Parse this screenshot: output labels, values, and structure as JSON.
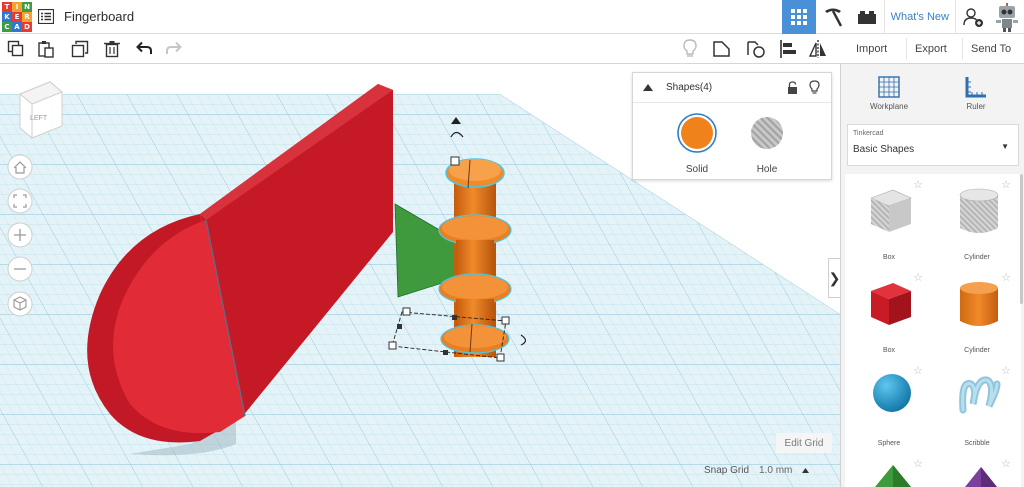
{
  "app": {
    "logo_letters": [
      "T",
      "I",
      "N",
      "K",
      "E",
      "R",
      "C",
      "A",
      "D"
    ],
    "logo_colors": [
      "#e63b2e",
      "#f3a230",
      "#3e9c46",
      "#2f77d1",
      "#e63b2e",
      "#f3a230",
      "#3e9c46",
      "#2f77d1",
      "#e63b2e"
    ],
    "document_title": "Fingerboard"
  },
  "header": {
    "whats_new": "What's New",
    "accent": "#4a90d9"
  },
  "toolbar": {
    "import_label": "Import",
    "export_label": "Export",
    "send_to_label": "Send To"
  },
  "viewcube": {
    "face_label": "LEFT"
  },
  "inspector": {
    "title": "Shapes(4)",
    "solid_label": "Solid",
    "hole_label": "Hole",
    "solid_color": "#f0821b"
  },
  "panel": {
    "workplane_label": "Workplane",
    "ruler_label": "Ruler",
    "library_source": "Tinkercad",
    "library_name": "Basic Shapes",
    "shapes": [
      {
        "label": "Box",
        "icon": "box-hole-icon"
      },
      {
        "label": "Cylinder",
        "icon": "cylinder-hole-icon"
      },
      {
        "label": "Box",
        "icon": "box-icon"
      },
      {
        "label": "Cylinder",
        "icon": "cylinder-icon"
      },
      {
        "label": "Sphere",
        "icon": "sphere-icon"
      },
      {
        "label": "Scribble",
        "icon": "scribble-icon"
      }
    ]
  },
  "footer": {
    "edit_grid_label": "Edit Grid",
    "snap_grid_label": "Snap Grid",
    "snap_grid_value": "1.0 mm"
  }
}
